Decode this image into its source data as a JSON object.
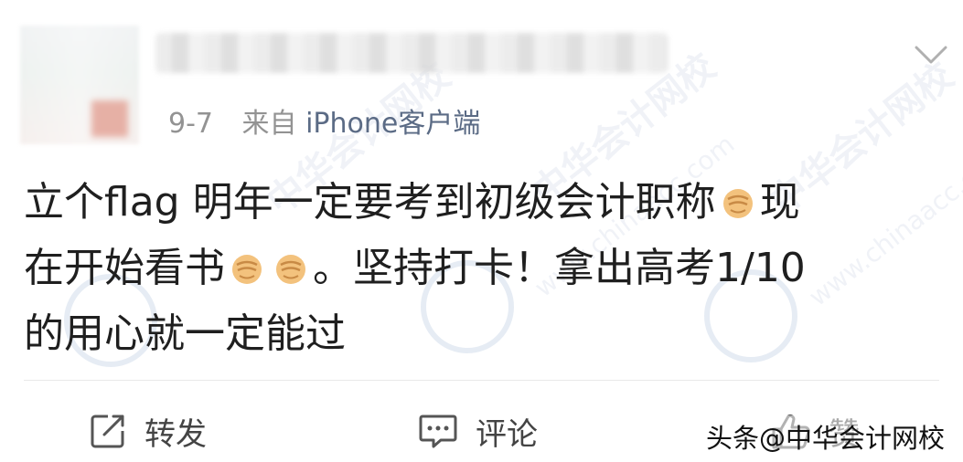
{
  "post": {
    "date": "9-7",
    "source_prefix": "来自",
    "source": "iPhone客户端",
    "text_line1": "立个flag 明年一定要考到初级会计职称",
    "text_line1_end": "现",
    "text_line2_a": "在开始看书",
    "text_line2_b": "。坚持打卡！拿出高考1/10",
    "text_line3": "的用心就一定能过"
  },
  "actions": {
    "repost_label": "转发",
    "comment_label": "评论",
    "like_label": "赞"
  },
  "icons": {
    "more": "chevron-down-icon",
    "repost": "repost-icon",
    "comment": "comment-icon",
    "like": "thumbs-up-icon",
    "emoji": "fist-emoji-icon"
  },
  "watermark": {
    "text": "头条@中华会计网校"
  },
  "colors": {
    "meta_gray": "#939393",
    "source_blue": "#5b6b85",
    "body_text": "#1f1f1f"
  }
}
